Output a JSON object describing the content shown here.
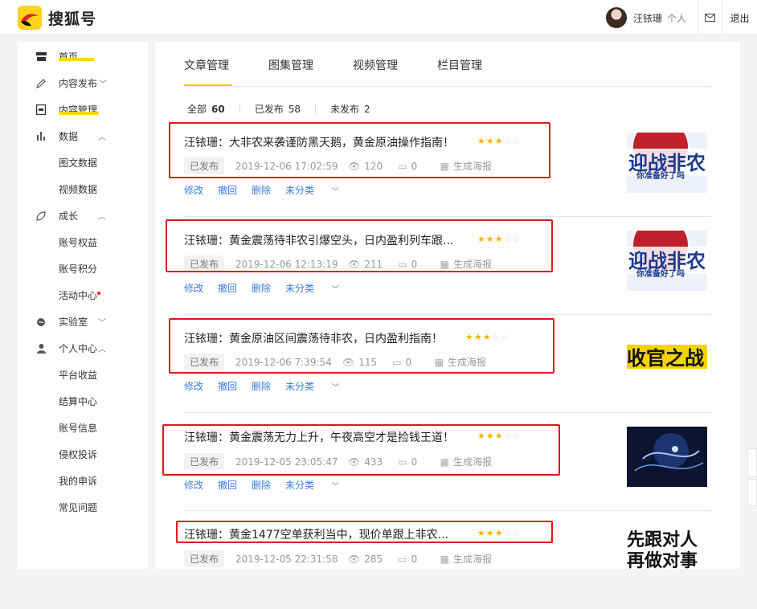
{
  "brand": {
    "name": "搜狐号"
  },
  "user": {
    "name": "汪铱珊",
    "role": "个人",
    "logout": "退出"
  },
  "sidebar": {
    "items": [
      {
        "label": "首页"
      },
      {
        "label": "内容发布"
      },
      {
        "label": "内容管理"
      },
      {
        "label": "数据"
      },
      {
        "label": "图文数据"
      },
      {
        "label": "视频数据"
      },
      {
        "label": "成长"
      },
      {
        "label": "账号权益"
      },
      {
        "label": "账号积分"
      },
      {
        "label": "活动中心"
      },
      {
        "label": "实验室"
      },
      {
        "label": "个人中心"
      },
      {
        "label": "平台收益"
      },
      {
        "label": "结算中心"
      },
      {
        "label": "账号信息"
      },
      {
        "label": "侵权投诉"
      },
      {
        "label": "我的申诉"
      },
      {
        "label": "常见问题"
      }
    ]
  },
  "tabs": [
    {
      "label": "文章管理"
    },
    {
      "label": "图集管理"
    },
    {
      "label": "视频管理"
    },
    {
      "label": "栏目管理"
    }
  ],
  "filters": [
    {
      "label": "全部",
      "count": "60"
    },
    {
      "label": "已发布",
      "count": "58"
    },
    {
      "label": "未发布",
      "count": "2"
    }
  ],
  "actions": {
    "edit": "修改",
    "withdraw": "撤回",
    "delete": "删除",
    "category": "未分类"
  },
  "status_label": "已发布",
  "poster_label": "生成海报",
  "articles": [
    {
      "title": "汪铱珊：大非农来袭谨防黑天鹅，黄金原油操作指南！",
      "time": "2019-12-06 17:02:59",
      "views": "120",
      "comments": "0",
      "stars": 3,
      "thumb_text": "迎战非农",
      "thumb_sub": "你准备好了吗"
    },
    {
      "title": "汪铱珊：黄金震荡待非农引爆空头，日内盈利列车跟...",
      "time": "2019-12-06 12:13:19",
      "views": "211",
      "comments": "0",
      "stars": 3,
      "thumb_text": "迎战非农",
      "thumb_sub": "你准备好了吗"
    },
    {
      "title": "汪铱珊：黄金原油区间震荡待非农，日内盈利指南！",
      "time": "2019-12-06 7:39:54",
      "views": "115",
      "comments": "0",
      "stars": 3,
      "thumb_text": "收官之战"
    },
    {
      "title": "汪铱珊：黄金震荡无力上升，午夜高空才是捡钱王道！",
      "time": "2019-12-05 23:05:47",
      "views": "433",
      "comments": "0",
      "stars": 3
    },
    {
      "title": "汪铱珊：黄金1477空单获利当中，现价单跟上非农...",
      "time": "2019-12-05 22:31:58",
      "views": "285",
      "comments": "0",
      "stars": 3,
      "thumb_text": "先跟对人",
      "thumb_sub": "再做对事"
    }
  ]
}
